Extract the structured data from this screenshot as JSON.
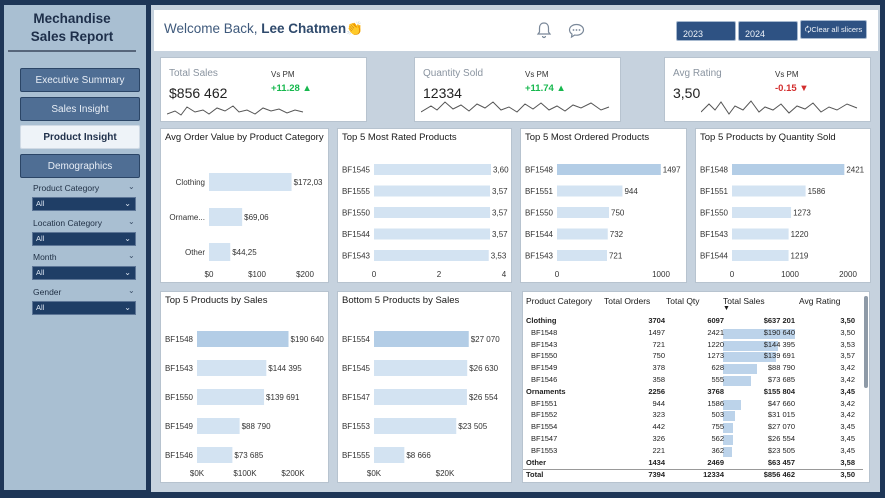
{
  "sidebar": {
    "logo_line1": "Mechandise",
    "logo_line2": "Sales Report",
    "nav": [
      "Executive Summary",
      "Sales Insight",
      "Product Insight",
      "Demographics"
    ],
    "active": 2,
    "filters": [
      {
        "label": "Product Category",
        "value": "All"
      },
      {
        "label": "Location Category",
        "value": "All"
      },
      {
        "label": "Month",
        "value": "All"
      },
      {
        "label": "Gender",
        "value": "All"
      }
    ]
  },
  "header": {
    "welcome": "Welcome Back,",
    "user": "Lee Chatmen👏",
    "years": [
      "2023",
      "2024"
    ],
    "clear": "🗘Clear all slicers"
  },
  "kpis": [
    {
      "title": "Total Sales",
      "value": "$856 462",
      "vs": "Vs PM",
      "delta": "+11.28 ▲",
      "dir": "up"
    },
    {
      "title": "Quantity Sold",
      "value": "12334",
      "vs": "Vs PM",
      "delta": "+11.74 ▲",
      "dir": "up"
    },
    {
      "title": "Avg Rating",
      "value": "3,50",
      "vs": "Vs PM",
      "delta": "-0.15 ▼",
      "dir": "down"
    }
  ],
  "chart_data": [
    {
      "type": "bar",
      "title": "Avg Order Value by Product Category",
      "categories": [
        "Clothing",
        "Ornamе...",
        "Other"
      ],
      "values": [
        172.03,
        69.06,
        44.25
      ],
      "labels": [
        "$172,03",
        "$69,06",
        "$44,25"
      ],
      "xticks": [
        "$0",
        "$100",
        "$200"
      ],
      "xlim": [
        0,
        200
      ]
    },
    {
      "type": "bar",
      "title": "Top 5 Most Rated Products",
      "categories": [
        "BF1545",
        "BF1555",
        "BF1550",
        "BF1544",
        "BF1543"
      ],
      "values": [
        3.6,
        3.57,
        3.57,
        3.57,
        3.53
      ],
      "labels": [
        "3,60",
        "3,57",
        "3,57",
        "3,57",
        "3,53"
      ],
      "xticks": [
        "0",
        "2",
        "4"
      ],
      "xlim": [
        0,
        4
      ]
    },
    {
      "type": "bar",
      "title": "Top 5 Most Ordered Products",
      "categories": [
        "BF1548",
        "BF1551",
        "BF1550",
        "BF1544",
        "BF1543"
      ],
      "values": [
        1497,
        944,
        750,
        732,
        721
      ],
      "labels": [
        "1497",
        "944",
        "750",
        "732",
        "721"
      ],
      "xticks": [
        "0",
        "1000"
      ],
      "xlim": [
        0,
        1500
      ]
    },
    {
      "type": "bar",
      "title": "Top 5 Products by Quantity Sold",
      "categories": [
        "BF1548",
        "BF1551",
        "BF1550",
        "BF1543",
        "BF1544"
      ],
      "values": [
        2421,
        1586,
        1273,
        1220,
        1219
      ],
      "labels": [
        "2421",
        "1586",
        "1273",
        "1220",
        "1219"
      ],
      "xticks": [
        "0",
        "1000",
        "2000"
      ],
      "xlim": [
        0,
        2500
      ]
    },
    {
      "type": "bar",
      "title": "Top 5 Products by Sales",
      "categories": [
        "BF1548",
        "BF1543",
        "BF1550",
        "BF1549",
        "BF1546"
      ],
      "values": [
        190640,
        144395,
        139691,
        88790,
        73685
      ],
      "labels": [
        "$190 640",
        "$144 395",
        "$139 691",
        "$88 790",
        "$73 685"
      ],
      "xticks": [
        "$0K",
        "$100K",
        "$200K"
      ],
      "xlim": [
        0,
        200000
      ]
    },
    {
      "type": "bar",
      "title": "Bottom 5 Products by Sales",
      "categories": [
        "BF1554",
        "BF1545",
        "BF1547",
        "BF1553",
        "BF1555"
      ],
      "values": [
        27070,
        26630,
        26554,
        23505,
        8666
      ],
      "labels": [
        "$27 070",
        "$26 630",
        "$26 554",
        "$23 505",
        "$8 666"
      ],
      "xticks": [
        "$0K",
        "$20K"
      ],
      "xlim": [
        0,
        28000
      ]
    }
  ],
  "table": {
    "headers": [
      "Product Category",
      "Total Orders",
      "Total Qty",
      "Total Sales",
      "Avg Rating"
    ],
    "sort_indicator": "▼",
    "rows": [
      {
        "name": "Clothing",
        "orders": "3704",
        "qty": "6097",
        "sales": "$637 201",
        "rating": "3,50",
        "bold": true,
        "v": 0
      },
      {
        "name": "BF1548",
        "orders": "1497",
        "qty": "2421",
        "sales": "$190 640",
        "rating": "3,50",
        "v": 190640
      },
      {
        "name": "BF1543",
        "orders": "721",
        "qty": "1220",
        "sales": "$144 395",
        "rating": "3,53",
        "v": 144395
      },
      {
        "name": "BF1550",
        "orders": "750",
        "qty": "1273",
        "sales": "$139 691",
        "rating": "3,57",
        "v": 139691
      },
      {
        "name": "BF1549",
        "orders": "378",
        "qty": "628",
        "sales": "$88 790",
        "rating": "3,42",
        "v": 88790
      },
      {
        "name": "BF1546",
        "orders": "358",
        "qty": "555",
        "sales": "$73 685",
        "rating": "3,42",
        "v": 73685
      },
      {
        "name": "Ornaments",
        "orders": "2256",
        "qty": "3768",
        "sales": "$155 804",
        "rating": "3,45",
        "bold": true,
        "v": 0
      },
      {
        "name": "BF1551",
        "orders": "944",
        "qty": "1586",
        "sales": "$47 660",
        "rating": "3,42",
        "v": 47660
      },
      {
        "name": "BF1552",
        "orders": "323",
        "qty": "503",
        "sales": "$31 015",
        "rating": "3,42",
        "v": 31015
      },
      {
        "name": "BF1554",
        "orders": "442",
        "qty": "755",
        "sales": "$27 070",
        "rating": "3,45",
        "v": 27070
      },
      {
        "name": "BF1547",
        "orders": "326",
        "qty": "562",
        "sales": "$26 554",
        "rating": "3,45",
        "v": 26554
      },
      {
        "name": "BF1553",
        "orders": "221",
        "qty": "362",
        "sales": "$23 505",
        "rating": "3,45",
        "v": 23505
      },
      {
        "name": "Other",
        "orders": "1434",
        "qty": "2469",
        "sales": "$63 457",
        "rating": "3,58",
        "bold": true,
        "v": 0
      },
      {
        "name": "Total",
        "orders": "7394",
        "qty": "12334",
        "sales": "$856 462",
        "rating": "3,50",
        "bold": true,
        "v": 0
      }
    ]
  },
  "colors": {
    "bar": "#bcd3ea",
    "accent": "#2e5283",
    "positive": "#17b84e",
    "negative": "#d32f2f"
  }
}
